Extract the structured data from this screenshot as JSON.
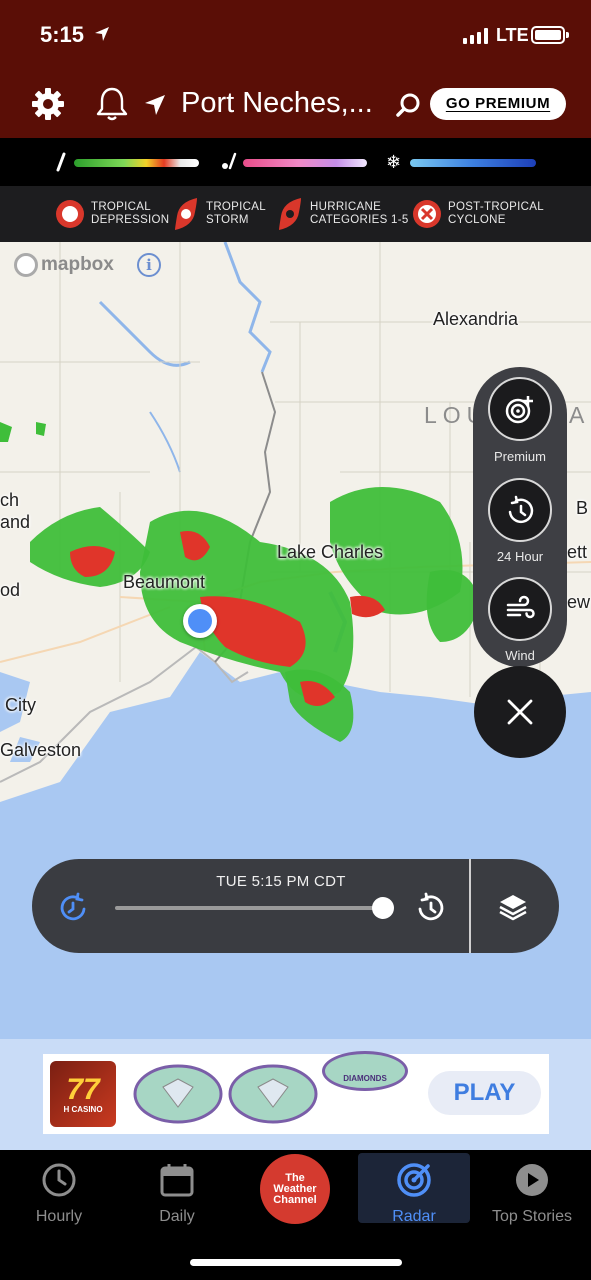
{
  "status_bar": {
    "time": "5:15",
    "network": "LTE"
  },
  "header": {
    "location": "Port Neches,...",
    "premium_label": "GO PREMIUM"
  },
  "legend": {
    "storm_types": [
      {
        "label": "TROPICAL\nDEPRESSION",
        "icon": "tropical-depression-icon"
      },
      {
        "label": "TROPICAL\nSTORM",
        "icon": "tropical-storm-icon"
      },
      {
        "label": "HURRICANE\nCATEGORIES 1-5",
        "icon": "hurricane-icon"
      },
      {
        "label": "POST-TROPICAL\nCYCLONE",
        "icon": "post-tropical-cyclone-icon"
      }
    ],
    "precip_types": [
      "rain-icon",
      "mix-icon",
      "snow-icon"
    ]
  },
  "map": {
    "attribution": "mapbox",
    "labels": {
      "alexandria": "Alexandria",
      "louisiana_left": "LOU",
      "louisiana_right": "A",
      "lake_charles": "Lake Charles",
      "beaumont": "Beaumont",
      "city": "City",
      "galveston": "Galveston",
      "partial_1": "ch",
      "partial_2": "and",
      "partial_3": "od",
      "partial_4": "B",
      "partial_5": "ett",
      "partial_6": "ew"
    }
  },
  "controls": {
    "premium_label": "Premium",
    "hour24_label": "24 Hour",
    "wind_label": "Wind"
  },
  "timeline": {
    "timestamp": "TUE 5:15 PM CDT",
    "progress": 1.0
  },
  "ad": {
    "brand": "H CASINO",
    "cta": "PLAY",
    "title_text": "DIAMONDS"
  },
  "tabs": {
    "hourly": "Hourly",
    "daily": "Daily",
    "twc_line1": "The",
    "twc_line2": "Weather",
    "twc_line3": "Channel",
    "radar": "Radar",
    "top_stories": "Top Stories",
    "active": "Radar"
  },
  "colors": {
    "header_bg": "#5a0e06",
    "accent_blue": "#4f8ff7",
    "water": "#a9c8f2",
    "radar_green": "#3fbe3a",
    "radar_red": "#e0352a"
  }
}
